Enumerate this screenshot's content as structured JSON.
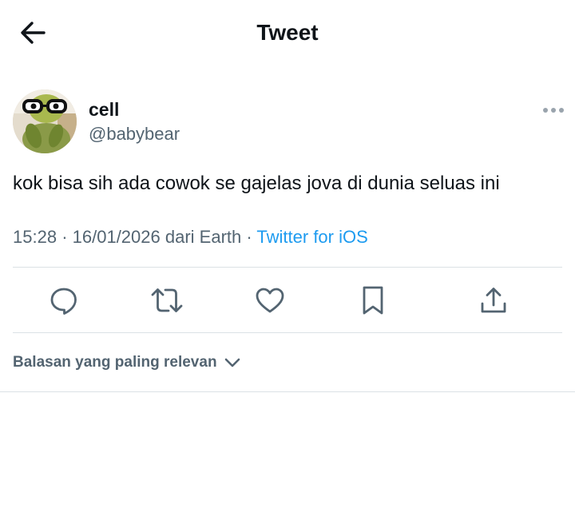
{
  "header": {
    "title": "Tweet",
    "back_icon": "arrow-left-icon"
  },
  "tweet": {
    "author": {
      "display_name": "cell",
      "handle": "@babybear",
      "avatar_icon": "avatar-image"
    },
    "text": "kok bisa sih ada cowok se gajelas jova di dunia seluas ini",
    "time": "15:28",
    "separator": "·",
    "date_location": "16/01/2026 dari Earth",
    "source": "Twitter for iOS",
    "more_icon": "more-dots-icon"
  },
  "actions": [
    {
      "name": "reply",
      "icon": "reply-icon"
    },
    {
      "name": "retweet",
      "icon": "retweet-icon"
    },
    {
      "name": "like",
      "icon": "heart-icon"
    },
    {
      "name": "bookmark",
      "icon": "bookmark-icon"
    },
    {
      "name": "share",
      "icon": "share-icon"
    }
  ],
  "replies": {
    "sort_label": "Balasan yang paling relevan",
    "sort_icon": "chevron-down-icon"
  },
  "colors": {
    "text_primary": "#0f1419",
    "text_secondary": "#536471",
    "accent": "#1d9bf0",
    "divider": "#dbe1e5"
  }
}
